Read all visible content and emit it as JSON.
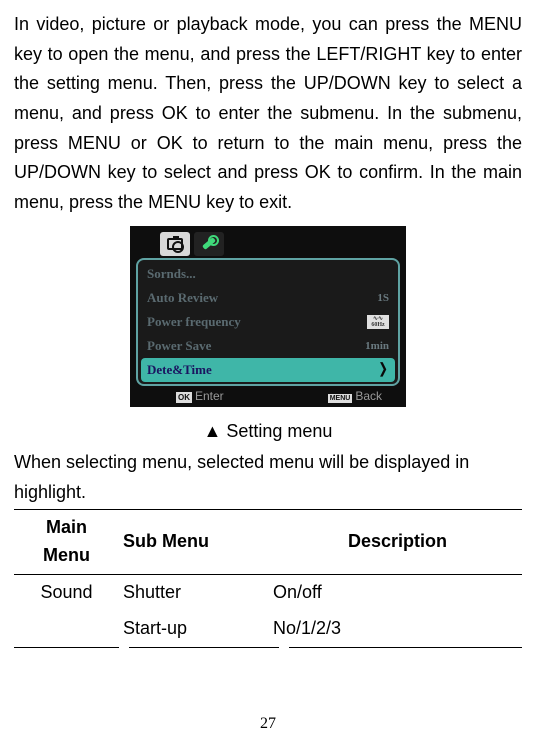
{
  "paragraph1": "In video, picture or playback mode, you can press the MENU key to open the menu, and press the LEFT/RIGHT key to enter the setting menu. Then, press the UP/DOWN key to select a menu, and press OK to enter the submenu. In the submenu, press MENU or OK to return to the main menu, press the UP/DOWN key to select and press OK to confirm. In the main menu, press the MENU key to exit.",
  "screenshot": {
    "menu_items": {
      "i0": {
        "label": "Sornds...",
        "value": ""
      },
      "i1": {
        "label": "Auto Review",
        "value": "1S"
      },
      "i2": {
        "label": "Power frequency",
        "value": "60Hz"
      },
      "i3": {
        "label": "Power Save",
        "value": "1min"
      },
      "i4": {
        "label": "Dete&Time",
        "value": "❭"
      }
    },
    "bottom": {
      "ok_badge": "OK",
      "enter": "Enter",
      "menu_badge": "MENU",
      "back": "Back"
    }
  },
  "caption": "▲ Setting menu",
  "paragraph2": "When selecting menu, selected menu will be displayed in highlight.",
  "table": {
    "headers": {
      "c1a": "Main",
      "c1b": "Menu",
      "c2": "Sub Menu",
      "c3": "Description"
    },
    "r1": {
      "c1": "Sound",
      "c2": "Shutter",
      "c3": "On/off"
    },
    "r2": {
      "c1": "",
      "c2": "Start-up",
      "c3": "No/1/2/3"
    }
  },
  "page_number": "27"
}
